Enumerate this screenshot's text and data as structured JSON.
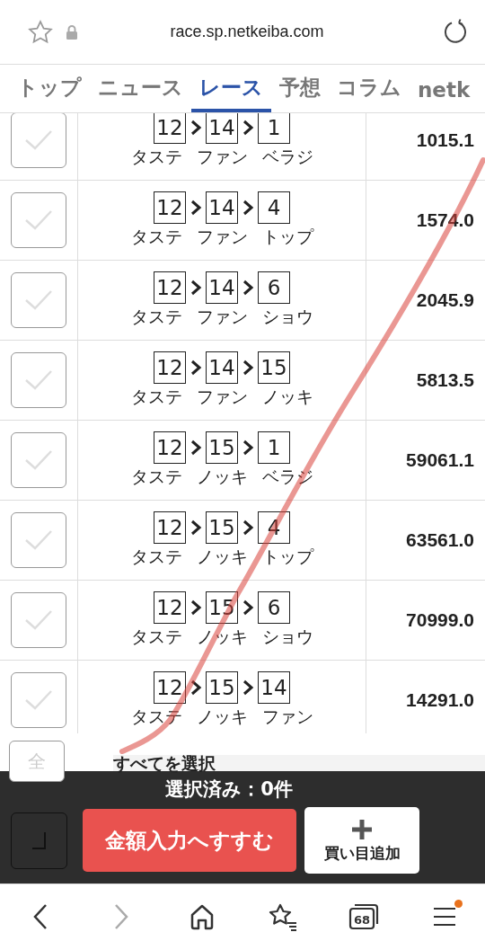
{
  "address_bar": {
    "url": "race.sp.netkeiba.com"
  },
  "tabs": [
    {
      "label": "トップ",
      "selected": false
    },
    {
      "label": "ニュース",
      "selected": false
    },
    {
      "label": "レース",
      "selected": true
    },
    {
      "label": "予想",
      "selected": false
    },
    {
      "label": "コラム",
      "selected": false
    },
    {
      "label": "netk",
      "selected": false
    }
  ],
  "rows": [
    {
      "checked": false,
      "numbers": [
        "12",
        "14",
        "1"
      ],
      "names": [
        "タステ",
        "ファン",
        "ベラジ"
      ],
      "odds": "1015.1"
    },
    {
      "checked": false,
      "numbers": [
        "12",
        "14",
        "4"
      ],
      "names": [
        "タステ",
        "ファン",
        "トップ"
      ],
      "odds": "1574.0"
    },
    {
      "checked": false,
      "numbers": [
        "12",
        "14",
        "6"
      ],
      "names": [
        "タステ",
        "ファン",
        "ショウ"
      ],
      "odds": "2045.9"
    },
    {
      "checked": false,
      "numbers": [
        "12",
        "14",
        "15"
      ],
      "names": [
        "タステ",
        "ファン",
        "ノッキ"
      ],
      "odds": "5813.5"
    },
    {
      "checked": false,
      "numbers": [
        "12",
        "15",
        "1"
      ],
      "names": [
        "タステ",
        "ノッキ",
        "ベラジ"
      ],
      "odds": "59061.1"
    },
    {
      "checked": false,
      "numbers": [
        "12",
        "15",
        "4"
      ],
      "names": [
        "タステ",
        "ノッキ",
        "トップ"
      ],
      "odds": "63561.0"
    },
    {
      "checked": false,
      "numbers": [
        "12",
        "15",
        "6"
      ],
      "names": [
        "タステ",
        "ノッキ",
        "ショウ"
      ],
      "odds": "70999.0"
    },
    {
      "checked": false,
      "numbers": [
        "12",
        "15",
        "14"
      ],
      "names": [
        "タステ",
        "ノッキ",
        "ファン"
      ],
      "odds": "14291.0"
    }
  ],
  "select_all": {
    "checked": false,
    "icon_label": "全",
    "label": "すべてを選択"
  },
  "footer": {
    "selected_count": "選択済み：0件",
    "proceed_button": "金額入力へすすむ",
    "add_button": "買い目追加"
  },
  "bottom_nav": {
    "back_disabled": false,
    "forward_disabled": true,
    "tab_count": "68",
    "menu_notification": true
  }
}
